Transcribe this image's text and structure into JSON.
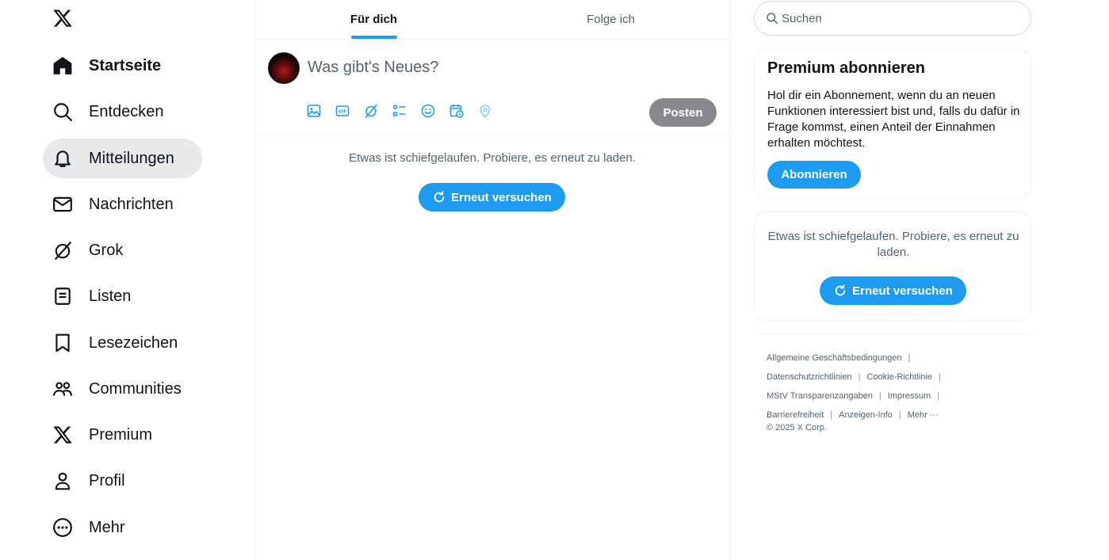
{
  "nav": {
    "items": [
      {
        "label": "Startseite",
        "icon": "home-icon"
      },
      {
        "label": "Entdecken",
        "icon": "search-icon"
      },
      {
        "label": "Mitteilungen",
        "icon": "bell-icon"
      },
      {
        "label": "Nachrichten",
        "icon": "envelope-icon"
      },
      {
        "label": "Grok",
        "icon": "grok-icon"
      },
      {
        "label": "Listen",
        "icon": "list-icon"
      },
      {
        "label": "Lesezeichen",
        "icon": "bookmark-icon"
      },
      {
        "label": "Communities",
        "icon": "communities-icon"
      },
      {
        "label": "Premium",
        "icon": "x-logo-icon"
      },
      {
        "label": "Profil",
        "icon": "profile-icon"
      },
      {
        "label": "Mehr",
        "icon": "more-icon"
      }
    ],
    "active_item": "Mitteilungen"
  },
  "main": {
    "tabs": [
      {
        "label": "Für dich",
        "active": true
      },
      {
        "label": "Folge ich",
        "active": false
      }
    ],
    "composer": {
      "placeholder": "Was gibt's Neues?",
      "tools": [
        "image-icon",
        "gif-icon",
        "grok-icon",
        "poll-icon",
        "emoji-icon",
        "schedule-icon",
        "location-icon"
      ],
      "post_label": "Posten"
    },
    "error_text": "Etwas ist schiefgelaufen. Probiere, es erneut zu laden.",
    "retry_label": "Erneut versuchen"
  },
  "sidebar": {
    "search_placeholder": "Suchen",
    "premium": {
      "title": "Premium abonnieren",
      "text": "Hol dir ein Abonnement, wenn du an neuen Funktionen interessiert bist und, falls du dafür in Frage kommst, einen Anteil der Einnahmen erhalten möchtest.",
      "button_label": "Abonnieren"
    },
    "error_card": {
      "text": "Etwas ist schiefgelaufen. Probiere, es erneut zu laden.",
      "retry_label": "Erneut versuchen"
    },
    "footer": {
      "links": [
        "Allgemeine Geschäftsbedingungen",
        "Datenschutzrichtlinien",
        "Cookie-Richtlinie",
        "MStV Transparenzangaben",
        "Impressum",
        "Barrierefreiheit",
        "Anzeigen-Info",
        "Mehr ···"
      ],
      "copyright": "© 2025 X Corp."
    }
  },
  "colors": {
    "accent": "#1d9bf0",
    "text_primary": "#0f1419",
    "text_secondary": "#536471",
    "post_button_disabled": "#87898c",
    "active_nav_bg": "#e7e9ea"
  }
}
